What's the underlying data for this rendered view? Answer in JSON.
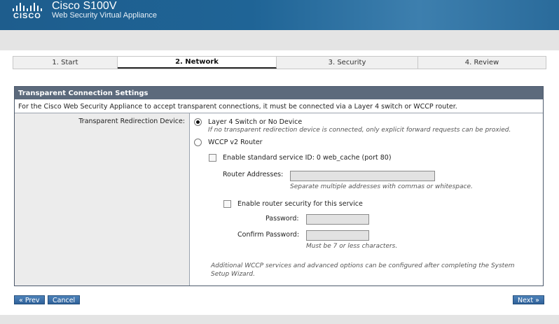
{
  "header": {
    "brand": "CISCO",
    "product": "Cisco S100V",
    "subtitle": "Web Security Virtual Appliance"
  },
  "tabs": [
    {
      "label": "1. Start",
      "active": false
    },
    {
      "label": "2. Network",
      "active": true
    },
    {
      "label": "3. Security",
      "active": false
    },
    {
      "label": "4. Review",
      "active": false
    }
  ],
  "panel": {
    "title": "Transparent Connection Settings",
    "description": "For the Cisco Web Security Appliance to accept transparent connections, it must be connected via a Layer 4 switch or WCCP router.",
    "field_label": "Transparent Redirection Device:",
    "option_layer4": {
      "label": "Layer 4 Switch or No Device",
      "hint": "If no transparent redirection device is connected, only explicit forward requests can be proxied.",
      "selected": true
    },
    "option_wccp": {
      "label": "WCCP v2 Router",
      "selected": false
    },
    "standard_service": {
      "label": "Enable standard service ID: 0 web_cache (port 80)",
      "checked": false
    },
    "router_addresses": {
      "label": "Router Addresses:",
      "value": "",
      "hint": "Separate multiple addresses with commas or whitespace."
    },
    "router_security": {
      "label": "Enable router security for this service",
      "checked": false
    },
    "password": {
      "label": "Password:",
      "value": ""
    },
    "confirm_password": {
      "label": "Confirm Password:",
      "value": "",
      "hint": "Must be 7 or less characters."
    },
    "footer_note_line1": "Additional WCCP services and advanced options can be configured after completing the System",
    "footer_note_line2": "Setup Wizard."
  },
  "buttons": {
    "prev": "« Prev",
    "cancel": "Cancel",
    "next": "Next »"
  },
  "colors": {
    "header_blue": "#1f6496",
    "panel_title": "#5c6a7c",
    "button_blue": "#2f6199"
  }
}
